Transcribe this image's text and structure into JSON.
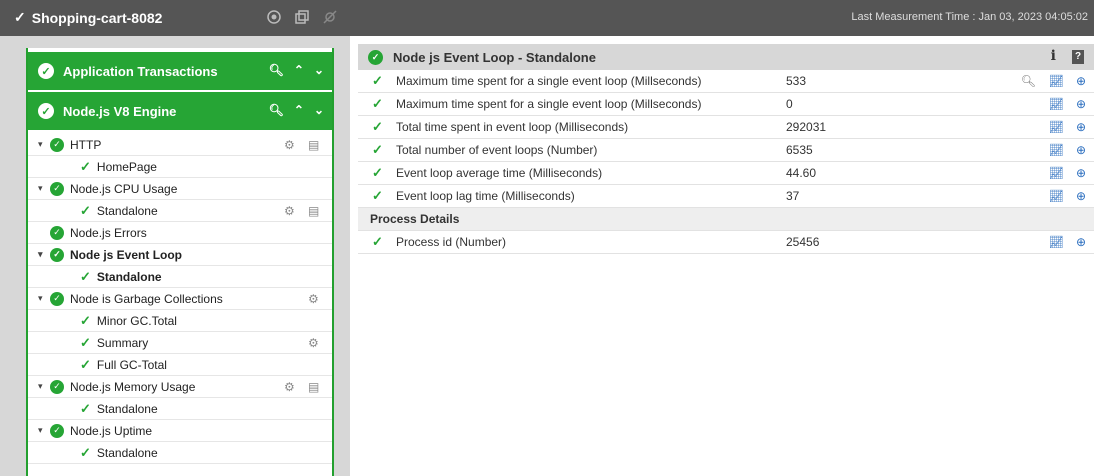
{
  "topbar": {
    "host": "Shopping-cart-8082",
    "measurement": "Last Measurement Time : Jan 03, 2023 04:05:02"
  },
  "left": {
    "groups": [
      {
        "label": "Application Transactions"
      },
      {
        "label": "Node.js V8 Engine"
      }
    ],
    "tree": [
      {
        "label": "HTTP",
        "level": 0,
        "bold": false
      },
      {
        "label": "HomePage",
        "level": 1,
        "bold": false
      },
      {
        "label": "Node.js CPU Usage",
        "level": 0,
        "bold": false
      },
      {
        "label": "Standalone",
        "level": 1,
        "bold": false
      },
      {
        "label": "Node.js Errors",
        "level": 0,
        "bold": false
      },
      {
        "label": "Node js Event Loop",
        "level": 0,
        "bold": true
      },
      {
        "label": "Standalone",
        "level": 1,
        "bold": true
      },
      {
        "label": "Node is Garbage Collections",
        "level": 0,
        "bold": false
      },
      {
        "label": "Minor GC.Total",
        "level": 1,
        "bold": false
      },
      {
        "label": "Summary",
        "level": 1,
        "bold": false
      },
      {
        "label": "Full GC-Total",
        "level": 1,
        "bold": false
      },
      {
        "label": "Node.js Memory Usage",
        "level": 0,
        "bold": false
      },
      {
        "label": "Standalone",
        "level": 1,
        "bold": false
      },
      {
        "label": "Node.js Uptime",
        "level": 0,
        "bold": false
      },
      {
        "label": "Standalone",
        "level": 1,
        "bold": false
      }
    ]
  },
  "right": {
    "title": "Node js Event Loop - Standalone",
    "info_label": "i",
    "help_label": "?",
    "rows": [
      {
        "label": "Maximum time spent for a single event loop (Millseconds)",
        "value": "533"
      },
      {
        "label": "Maximum time spent for a single event loop (Millseconds)",
        "value": "0"
      },
      {
        "label": "Total time spent in event loop (Milliseconds)",
        "value": "292031"
      },
      {
        "label": "Total number of event loops (Number)",
        "value": "6535"
      },
      {
        "label": "Event loop average time (Milliseconds)",
        "value": "44.60"
      },
      {
        "label": "Event loop lag time (Milliseconds)",
        "value": "37"
      }
    ],
    "section": "Process Details",
    "process_rows": [
      {
        "label": "Process id (Number)",
        "value": "25456"
      }
    ]
  }
}
